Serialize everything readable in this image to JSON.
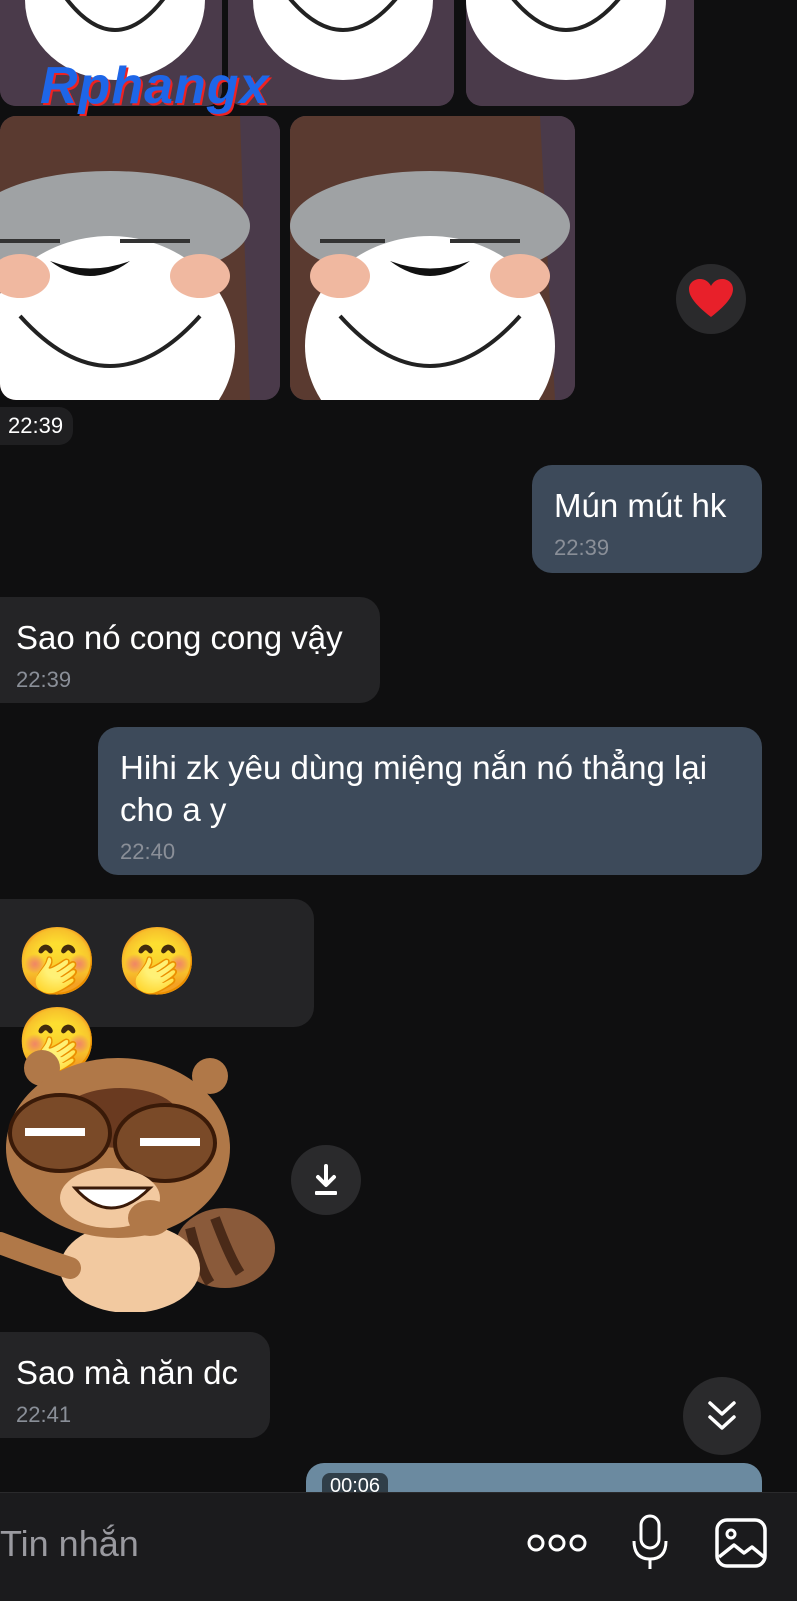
{
  "watermark": "Rphangx",
  "photo_group": {
    "time": "22:39",
    "reaction": "heart"
  },
  "messages": [
    {
      "side": "sent",
      "text": "Mún mút hk",
      "time": "22:39"
    },
    {
      "side": "received",
      "text": "Sao nó cong cong vậy",
      "time": "22:39"
    },
    {
      "side": "sent",
      "text": "Hihi zk yêu dùng miệng nắn nó thẳng lại cho a y",
      "time": "22:40"
    },
    {
      "side": "received",
      "text": "🤭🤭🤭",
      "time": ""
    },
    {
      "side": "received",
      "text": "Sao mà năn dc",
      "time": "22:41"
    }
  ],
  "video": {
    "duration": "00:06"
  },
  "input": {
    "placeholder": "Tin nhắn"
  },
  "icons": {
    "reaction": "heart-icon",
    "download": "download-icon",
    "scroll": "double-chevron-down-icon",
    "more": "more-icon",
    "mic": "microphone-icon",
    "gallery": "image-icon"
  },
  "colors": {
    "background": "#0f0f10",
    "sent_bubble": "#3d4a5a",
    "received_bubble": "#242426"
  }
}
